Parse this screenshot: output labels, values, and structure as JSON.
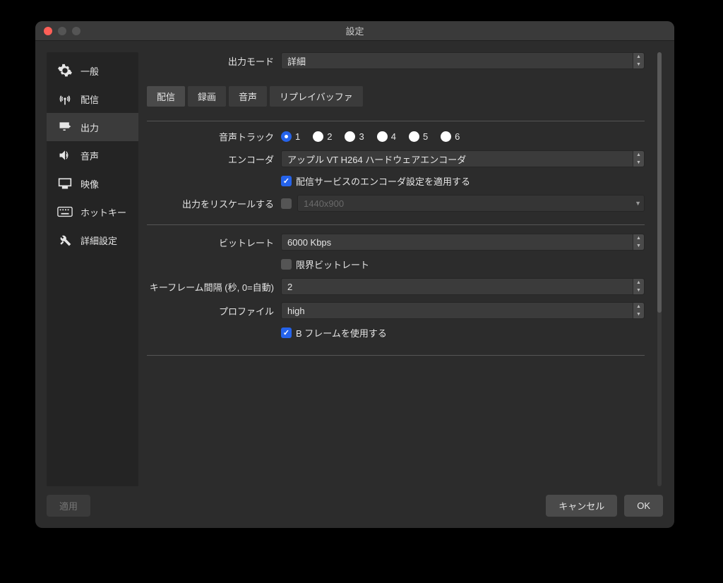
{
  "window": {
    "title": "設定"
  },
  "sidebar": {
    "items": [
      {
        "label": "一般"
      },
      {
        "label": "配信"
      },
      {
        "label": "出力"
      },
      {
        "label": "音声"
      },
      {
        "label": "映像"
      },
      {
        "label": "ホットキー"
      },
      {
        "label": "詳細設定"
      }
    ]
  },
  "output_mode": {
    "label": "出力モード",
    "value": "詳細"
  },
  "tabs": [
    {
      "label": "配信"
    },
    {
      "label": "録画"
    },
    {
      "label": "音声"
    },
    {
      "label": "リプレイバッファ"
    }
  ],
  "audio_track": {
    "label": "音声トラック",
    "options": [
      "1",
      "2",
      "3",
      "4",
      "5",
      "6"
    ],
    "selected": "1"
  },
  "encoder": {
    "label": "エンコーダ",
    "value": "アップル VT H264 ハードウェアエンコーダ"
  },
  "apply_service": {
    "label": "配信サービスのエンコーダ設定を適用する",
    "checked": true
  },
  "rescale": {
    "label": "出力をリスケールする",
    "checked": false,
    "value": "1440x900"
  },
  "bitrate": {
    "label": "ビットレート",
    "value": "6000 Kbps"
  },
  "limit_bitrate": {
    "label": "限界ビットレート",
    "checked": false
  },
  "keyframe": {
    "label": "キーフレーム間隔 (秒, 0=自動)",
    "value": "2"
  },
  "profile": {
    "label": "プロファイル",
    "value": "high"
  },
  "bframes": {
    "label": "B フレームを使用する",
    "checked": true
  },
  "buttons": {
    "apply": "適用",
    "cancel": "キャンセル",
    "ok": "OK"
  }
}
